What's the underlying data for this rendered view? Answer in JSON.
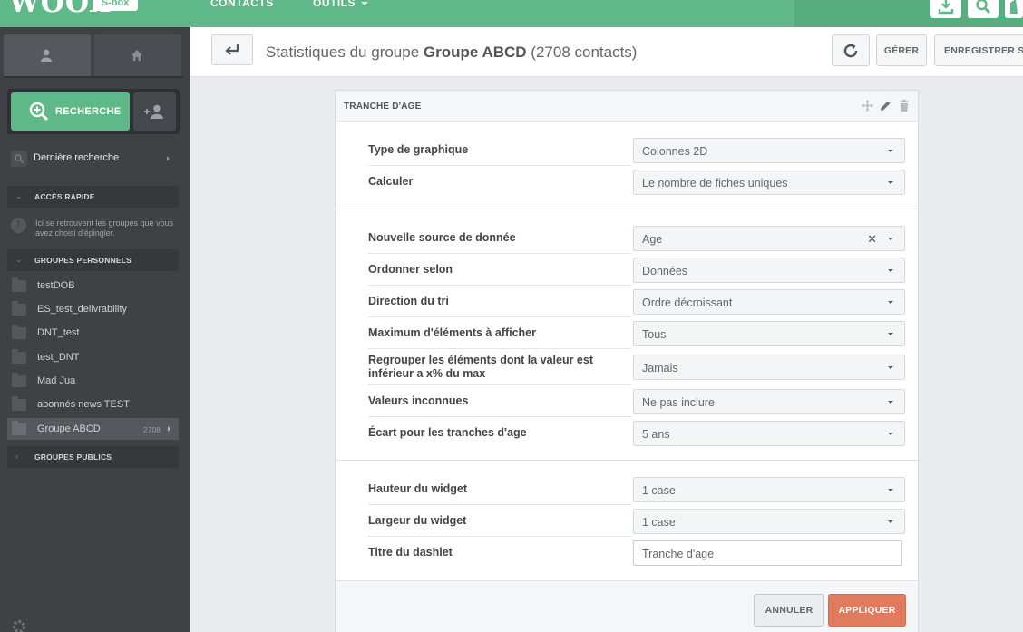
{
  "app": {
    "logo": "WOOX",
    "env_badge": "S-box",
    "nav": [
      "CONTACTS",
      "OUTILS"
    ]
  },
  "sidebar": {
    "search_button": "RECHERCHE",
    "last_search": "Dernière recherche",
    "quick_access": {
      "title": "ACCÈS RAPIDE",
      "info": "Ici se retrouvent les groupes que vous avez choisi d'épingler."
    },
    "personal_groups": {
      "title": "GROUPES PERSONNELS",
      "items": [
        {
          "label": "testDOB"
        },
        {
          "label": "ES_test_delivrability"
        },
        {
          "label": "DNT_test"
        },
        {
          "label": "test_DNT"
        },
        {
          "label": "Mad Jua"
        },
        {
          "label": "abonnés news TEST"
        },
        {
          "label": "Groupe ABCD",
          "count": "2708",
          "active": true
        }
      ]
    },
    "public_groups": {
      "title": "GROUPES PUBLICS"
    }
  },
  "header": {
    "title_prefix": "Statistiques du groupe",
    "group_name": "Groupe ABCD",
    "contact_count": "(2708 contacts)",
    "manage_label": "GÉRER",
    "save_label": "ENREGISTRER SOUS"
  },
  "panel": {
    "title": "TRANCHE D'AGE",
    "fields": {
      "chart_type": {
        "label": "Type de graphique",
        "value": "Colonnes 2D"
      },
      "compute": {
        "label": "Calculer",
        "value": "Le nombre de fiches uniques"
      },
      "data_source": {
        "label": "Nouvelle source de donnée",
        "value": "Age"
      },
      "order_by": {
        "label": "Ordonner selon",
        "value": "Données"
      },
      "sort_direction": {
        "label": "Direction du tri",
        "value": "Ordre décroissant"
      },
      "max_items": {
        "label": "Maximum d'éléments à afficher",
        "value": "Tous"
      },
      "group_below": {
        "label": "Regrouper les éléments dont la valeur est inférieur a x% du max",
        "value": "Jamais"
      },
      "unknown_values": {
        "label": "Valeurs inconnues",
        "value": "Ne pas inclure"
      },
      "age_gap": {
        "label": "Écart pour les tranches d'age",
        "value": "5 ans"
      },
      "widget_height": {
        "label": "Hauteur du widget",
        "value": "1 case"
      },
      "widget_width": {
        "label": "Largeur du widget",
        "value": "1 case"
      },
      "dashlet_title": {
        "label": "Titre du dashlet",
        "value": "Tranche d'age"
      }
    },
    "cancel_label": "ANNULER",
    "apply_label": "APPLIQUER"
  }
}
